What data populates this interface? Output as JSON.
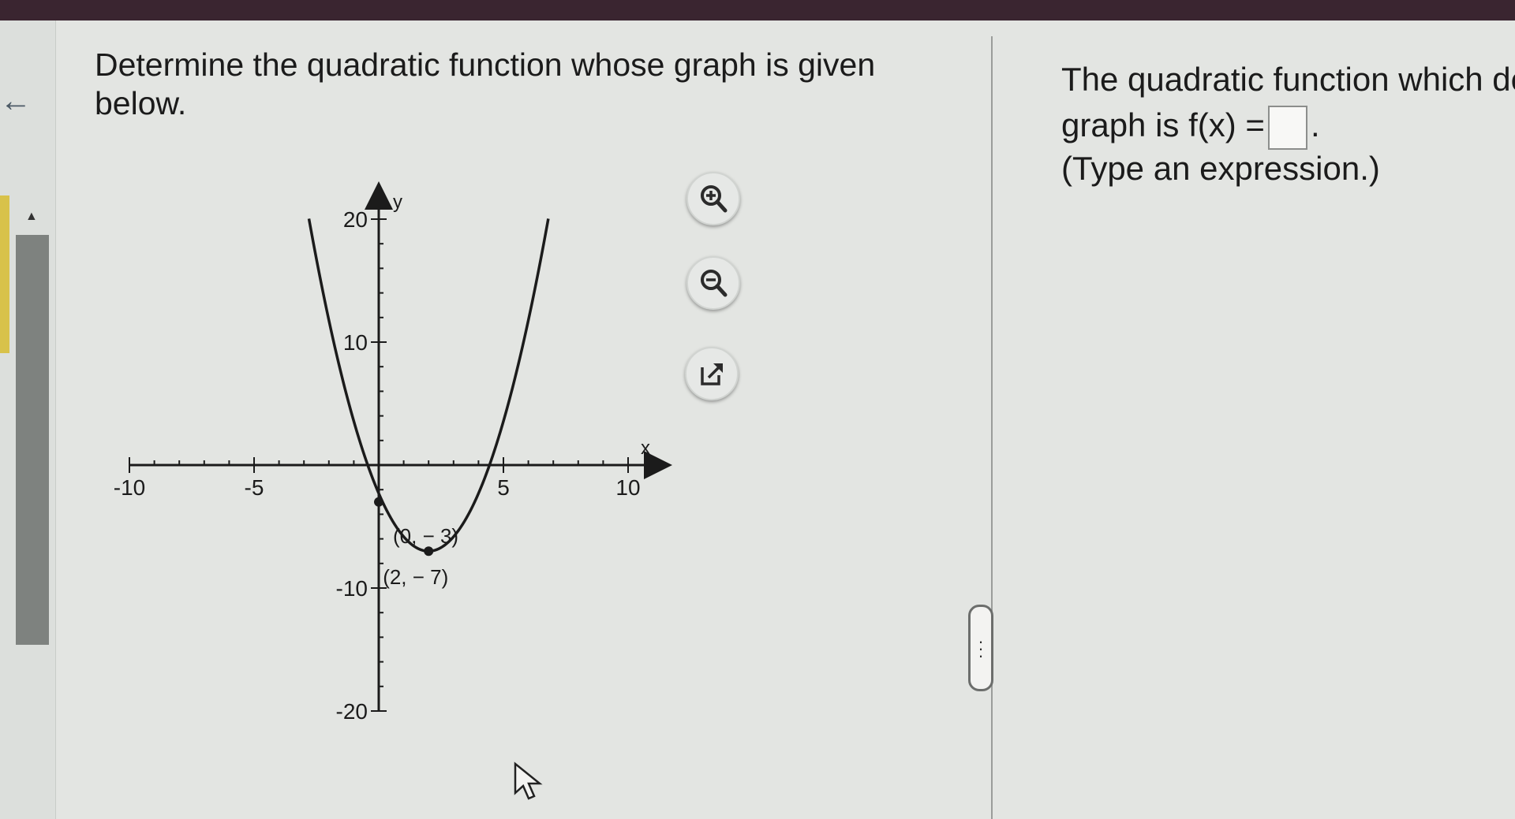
{
  "question": {
    "text": "Determine the quadratic function whose graph is given below."
  },
  "chart_data": {
    "type": "line",
    "xlabel": "x",
    "ylabel": "y",
    "xlim": [
      -10,
      10
    ],
    "ylim": [
      -20,
      20
    ],
    "x_ticks_labeled": [
      -10,
      -5,
      5,
      10
    ],
    "y_ticks_labeled": [
      20,
      10,
      -10,
      -20
    ],
    "tick_labels": {
      "x": [
        "-10",
        "-5",
        "5",
        "10"
      ],
      "y": [
        "20",
        "10",
        "-10",
        "-20"
      ]
    },
    "series": [
      {
        "curve": "parabola",
        "x": [
          -2.8,
          -2,
          -1,
          0,
          1,
          2,
          3,
          4,
          5,
          6,
          6.8
        ],
        "y": [
          20.04,
          9,
          2,
          -3,
          -6,
          -7,
          -6,
          -3,
          2,
          9,
          20.04
        ]
      }
    ],
    "points": [
      {
        "x": 0,
        "y": -3,
        "label": "(0, − 3)"
      },
      {
        "x": 2,
        "y": -7,
        "label": "(2, − 7)"
      }
    ],
    "grid": false
  },
  "tools": {
    "zoom_in": "zoom-in-icon",
    "zoom_out": "zoom-out-icon",
    "popout": "popout-icon"
  },
  "answer": {
    "line1": "The quadratic function which de",
    "line2_prefix": "graph is f(x) =",
    "line2_suffix": ".",
    "input_value": "",
    "instruction": "(Type an expression.)"
  }
}
